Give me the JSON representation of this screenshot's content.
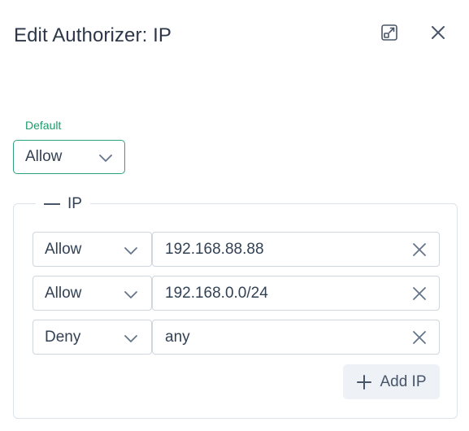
{
  "dialog": {
    "title": "Edit Authorizer: IP",
    "expand_icon": "expand-icon",
    "close_icon": "close-icon"
  },
  "default_field": {
    "label": "Default",
    "value": "Allow",
    "accent_color": "#2aa37a"
  },
  "ip_section": {
    "legend": "IP",
    "collapse_icon": "minus-icon",
    "rules": [
      {
        "action": "Allow",
        "address": "192.168.88.88"
      },
      {
        "action": "Allow",
        "address": "192.168.0.0/24"
      },
      {
        "action": "Deny",
        "address": "any"
      }
    ],
    "add_label": "Add IP",
    "add_icon": "plus-icon"
  }
}
